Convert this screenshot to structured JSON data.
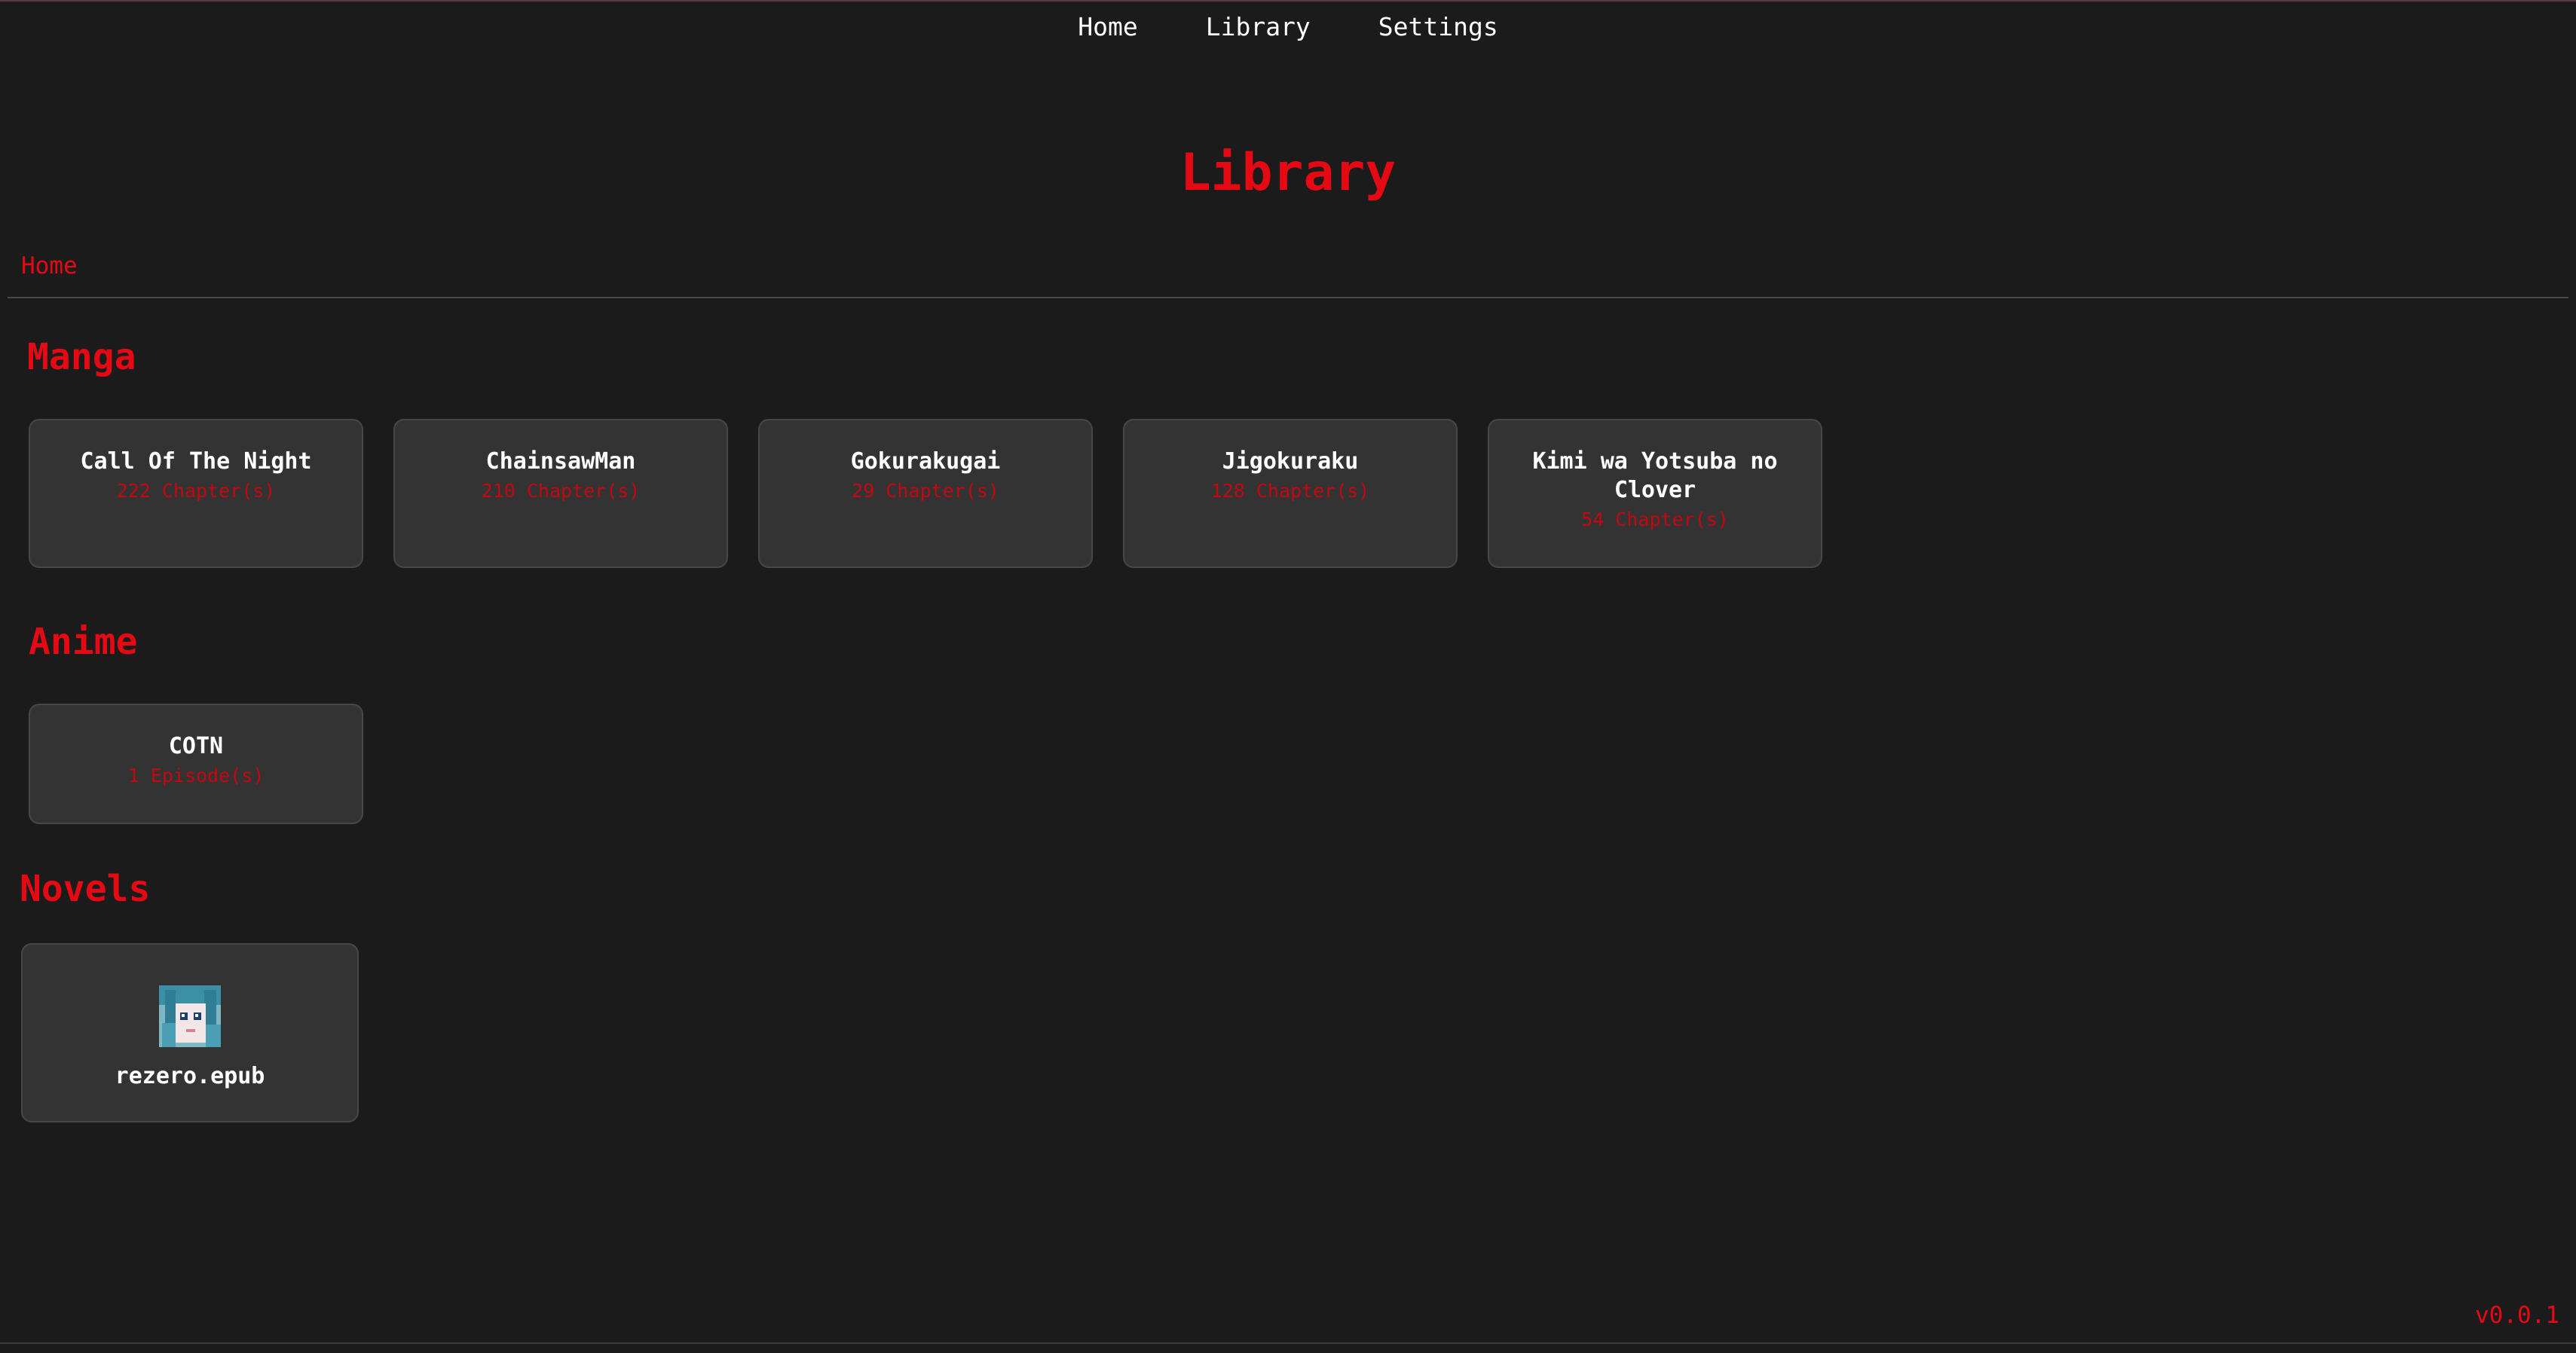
{
  "nav": {
    "items": [
      "Home",
      "Library",
      "Settings"
    ]
  },
  "page": {
    "title": "Library",
    "breadcrumb": "Home",
    "version": "v0.0.1"
  },
  "sections": {
    "manga": {
      "heading": "Manga",
      "items": [
        {
          "title": "Call Of The Night",
          "count": "222 Chapter(s)"
        },
        {
          "title": "ChainsawMan",
          "count": "210 Chapter(s)"
        },
        {
          "title": "Gokurakugai",
          "count": "29 Chapter(s)"
        },
        {
          "title": "Jigokuraku",
          "count": "128 Chapter(s)"
        },
        {
          "title": "Kimi wa Yotsuba no Clover",
          "count": "54 Chapter(s)"
        }
      ]
    },
    "anime": {
      "heading": "Anime",
      "items": [
        {
          "title": "COTN",
          "count": "1 Episode(s)"
        }
      ]
    },
    "novels": {
      "heading": "Novels",
      "items": [
        {
          "title": "rezero.epub",
          "cover_icon": "book-cover-thumbnail"
        }
      ]
    }
  },
  "colors": {
    "background": "#1b1b1b",
    "accent": "#e50914",
    "card": "#333333",
    "text": "#ffffff"
  }
}
